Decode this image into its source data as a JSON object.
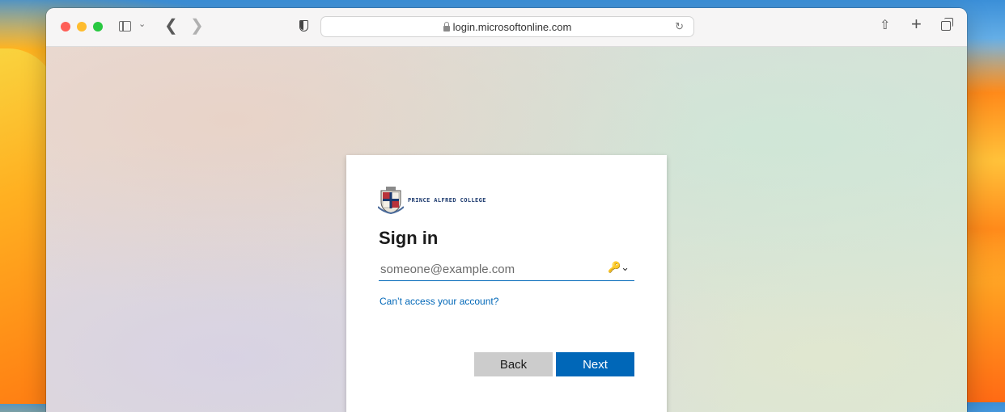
{
  "browser": {
    "url": "login.microsoftonline.com"
  },
  "signin": {
    "org_name": "PRINCE ALFRED COLLEGE",
    "title": "Sign in",
    "email_placeholder": "someone@example.com",
    "cant_access_link": "Can’t access your account?",
    "back_label": "Back",
    "next_label": "Next"
  },
  "colors": {
    "accent": "#0067b8",
    "back_button": "#cccccc"
  }
}
